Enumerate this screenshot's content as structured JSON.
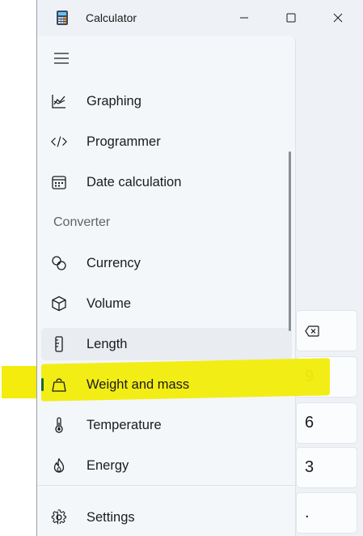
{
  "window": {
    "title": "Calculator",
    "icon": "calculator-app-icon",
    "controls": [
      "minimize-icon",
      "maximize-icon",
      "close-icon"
    ]
  },
  "nav": {
    "menu_icon": "hamburger-menu-icon",
    "items_top": [
      {
        "label": "Graphing",
        "icon": "graph-icon"
      },
      {
        "label": "Programmer",
        "icon": "code-icon"
      },
      {
        "label": "Date calculation",
        "icon": "calendar-icon"
      }
    ],
    "converter_header": "Converter",
    "converter_items": [
      {
        "label": "Currency",
        "icon": "currency-icon"
      },
      {
        "label": "Volume",
        "icon": "cube-icon"
      },
      {
        "label": "Length",
        "icon": "ruler-icon"
      },
      {
        "label": "Weight and mass",
        "icon": "weight-icon",
        "selected": true
      },
      {
        "label": "Temperature",
        "icon": "thermometer-icon"
      },
      {
        "label": "Energy",
        "icon": "flame-icon"
      }
    ],
    "settings": {
      "label": "Settings",
      "icon": "gear-icon"
    }
  },
  "background_keys": {
    "backspace_icon": "backspace-icon",
    "digits": [
      "9",
      "6",
      "3",
      "."
    ]
  },
  "colors": {
    "selection_indicator": "#0f6d2f",
    "highlighter": "#f3ec0c"
  }
}
